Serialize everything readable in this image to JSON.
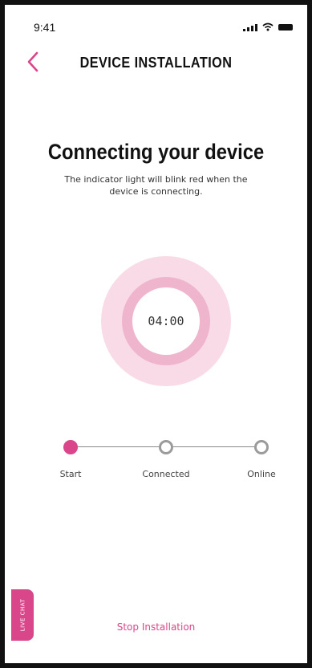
{
  "status_bar": {
    "time": "9:41",
    "icons": [
      "signal-icon",
      "wifi-icon",
      "battery-icon"
    ]
  },
  "header": {
    "back_icon": "chevron-left-icon",
    "title": "DEVICE INSTALLATION"
  },
  "main": {
    "headline": "Connecting your device",
    "subtext": "The indicator light will blink red when the device is connecting.",
    "timer": "04:00"
  },
  "stepper": {
    "steps": [
      {
        "label": "Start",
        "state": "active"
      },
      {
        "label": "Connected",
        "state": "pending"
      },
      {
        "label": "Online",
        "state": "pending"
      }
    ]
  },
  "live_chat": {
    "label": "LIVE CHAT"
  },
  "footer": {
    "stop_label": "Stop Installation"
  },
  "colors": {
    "accent": "#d9468a",
    "ring_outer": "#f9dbe7",
    "ring_mid": "#efb5cd",
    "inactive": "#9b9b9b"
  }
}
